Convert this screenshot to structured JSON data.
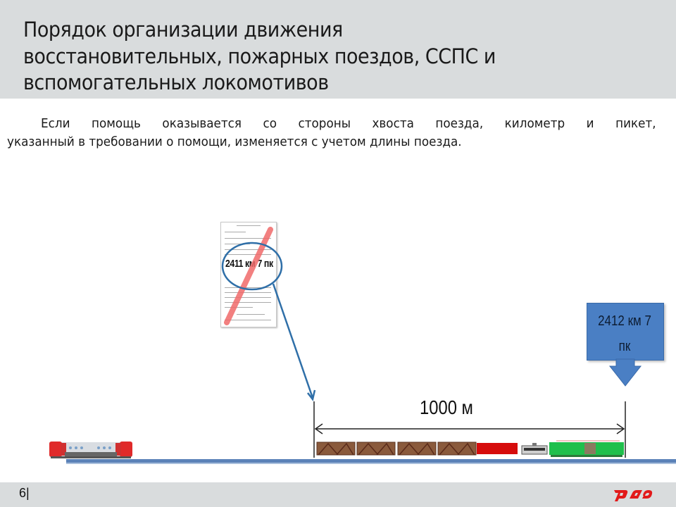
{
  "slide": {
    "title_lines": [
      "Порядок организации движения",
      "восстановительных, пожарных поездов, ССПС и",
      "вспомогательных локомотивов"
    ],
    "body_lines": [
      "Если помощь оказывается со стороны хвоста поезда, километр и пикет,",
      "указанный в требовании о помощи, изменяется с учетом длины поезда."
    ],
    "page_number": "6|",
    "logo_text": "РЖД"
  },
  "diagram": {
    "request_document": {
      "location_label": "2411 км 7 пк",
      "crossed_out": true
    },
    "target_marker": {
      "line1": "2412 км 7",
      "line2": "пк"
    },
    "distance_label": "1000 м",
    "train_cars": [
      "boxcar",
      "boxcar",
      "boxcar",
      "boxcar",
      "red-flatcar",
      "tank-car",
      "green-locomotive"
    ],
    "colors": {
      "track": "#5b82b8",
      "arrow": "#2f6fa8",
      "marker": "#4a7fc4",
      "strike": "#f06a6a",
      "logo": "#e21a1a"
    }
  }
}
